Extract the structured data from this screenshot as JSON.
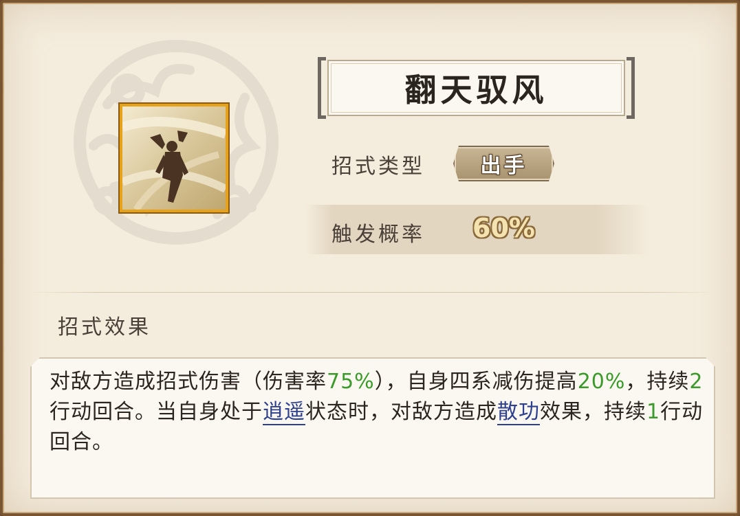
{
  "skill": {
    "name": "翻天驭风",
    "type_label": "招式类型",
    "type_value": "出手",
    "rate_label": "触发概率",
    "rate_value": "60%",
    "effect_heading": "招式效果",
    "description": {
      "p1": "对敌方造成招式伤害（伤害率",
      "v1": "75%",
      "p2": "），自身四系减伤提高",
      "v2": "20%",
      "p3": "，持续",
      "v3": "2",
      "p4": "行动回合。当自身处于",
      "link1": "逍遥",
      "p5": "状态时，对敌方造成",
      "link2": "散功",
      "p6": "效果，持续",
      "v4": "1",
      "p7": "行动回合。"
    }
  },
  "icons": {
    "emblem": "cloud-swirl-emblem-icon",
    "skill": "wind-warrior-skill-icon"
  },
  "colors": {
    "highlight_value": "#3a9a2a",
    "link": "#2d3f8f",
    "icon_border": "#e7a21b"
  }
}
